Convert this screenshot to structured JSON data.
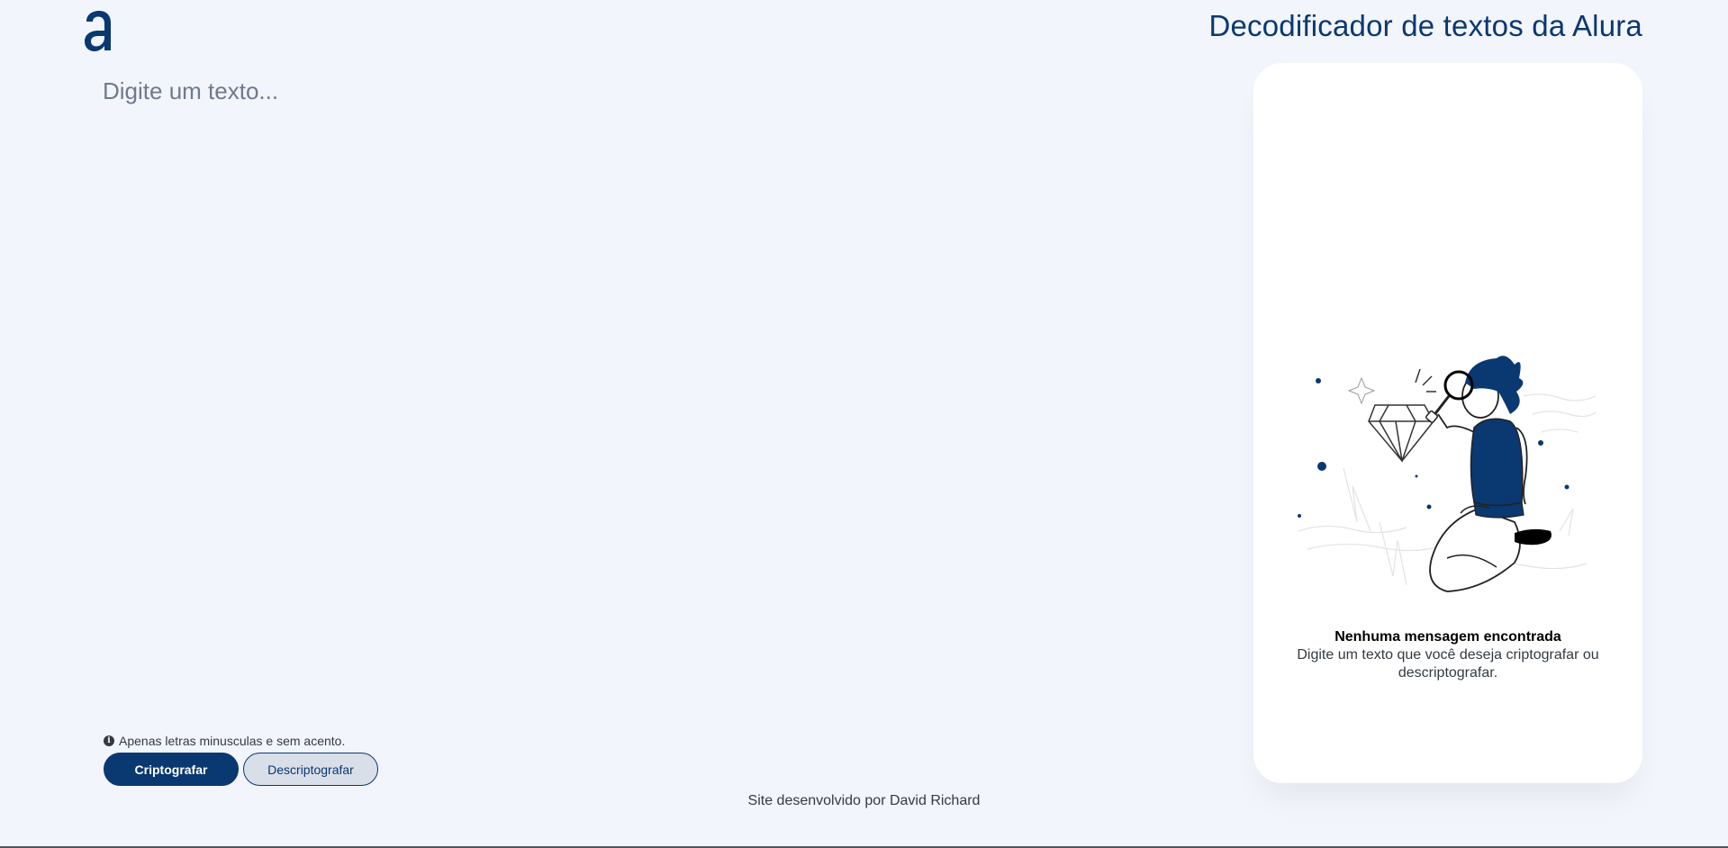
{
  "header": {
    "title": "Decodificador de textos da Alura",
    "logo_icon": "alura-logo-icon"
  },
  "input": {
    "placeholder": "Digite um texto...",
    "value": ""
  },
  "hint": {
    "icon": "info-circle-icon",
    "text": "Apenas letras minusculas e sem acento."
  },
  "buttons": {
    "encrypt_label": "Criptografar",
    "decrypt_label": "Descriptografar"
  },
  "output_panel": {
    "illustration": "person-with-magnifier-illustration",
    "title": "Nenhuma mensagem encontrada",
    "subtitle": "Digite um texto que você deseja criptografar ou descriptografar."
  },
  "footer": {
    "text": "Site desenvolvido por David Richard"
  },
  "colors": {
    "background": "#f3f5fc",
    "primary": "#0a3871",
    "secondary_button": "#d8dfe8",
    "panel": "#ffffff"
  }
}
